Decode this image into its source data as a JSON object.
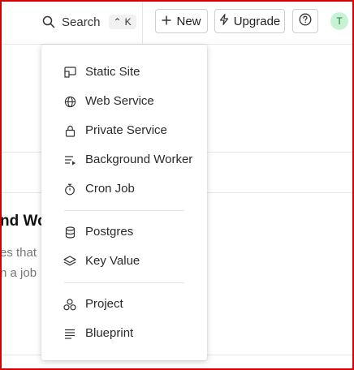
{
  "topbar": {
    "search_label": "Search",
    "search_shortcut_modifier": "⌃",
    "search_shortcut_key": "K",
    "new_label": "New",
    "upgrade_label": "Upgrade",
    "avatar_initial": "T"
  },
  "background": {
    "heading_fragment": "nd Wo",
    "text_line_1": "es that",
    "text_line_2": "n a job"
  },
  "menu": {
    "items": [
      {
        "label": "Static Site",
        "icon": "static-site-icon"
      },
      {
        "label": "Web Service",
        "icon": "globe-icon"
      },
      {
        "label": "Private Service",
        "icon": "lock-icon"
      },
      {
        "label": "Background Worker",
        "icon": "worker-icon"
      },
      {
        "label": "Cron Job",
        "icon": "stopwatch-icon"
      },
      {
        "label": "Postgres",
        "icon": "database-icon"
      },
      {
        "label": "Key Value",
        "icon": "layers-icon"
      },
      {
        "label": "Project",
        "icon": "project-icon"
      },
      {
        "label": "Blueprint",
        "icon": "blueprint-icon"
      }
    ]
  },
  "colors": {
    "frame_border": "#d60000",
    "avatar_bg": "#c7f3d4",
    "avatar_text": "#1b7a3b"
  }
}
